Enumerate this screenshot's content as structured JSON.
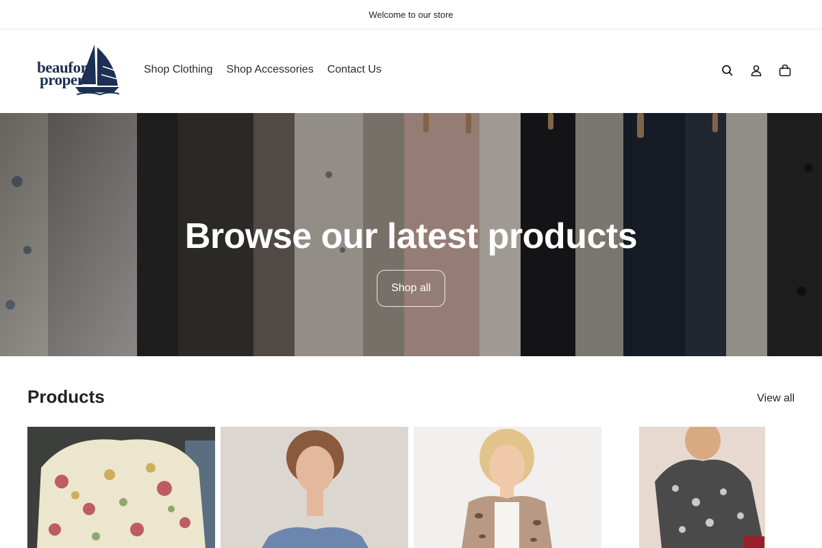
{
  "announcement": "Welcome to our store",
  "logo": {
    "line1": "beaufort",
    "line2": "proper"
  },
  "nav": [
    "Shop Clothing",
    "Shop Accessories",
    "Contact Us"
  ],
  "icons": [
    "search-icon",
    "account-icon",
    "cart-icon"
  ],
  "hero": {
    "title": "Browse our latest products",
    "button": "Shop all"
  },
  "products": {
    "title": "Products",
    "view_all": "View all"
  },
  "colors": {
    "brand_navy": "#1c2f55",
    "text": "#121212"
  }
}
